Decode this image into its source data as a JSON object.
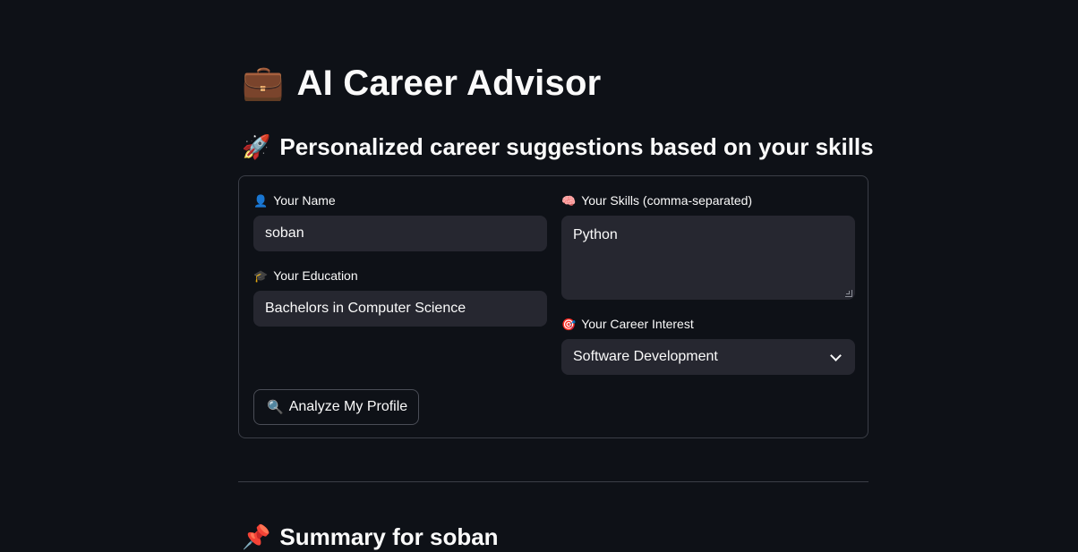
{
  "header": {
    "title_icon": "💼",
    "title": "AI Career Advisor",
    "subtitle_icon": "🚀",
    "subtitle": "Personalized career suggestions based on your skills"
  },
  "form": {
    "name": {
      "icon": "👤",
      "label": "Your Name",
      "value": "soban"
    },
    "education": {
      "icon": "🎓",
      "label": "Your Education",
      "value": "Bachelors in Computer Science"
    },
    "skills": {
      "icon": "🧠",
      "label": "Your Skills (comma-separated)",
      "value": "Python"
    },
    "interest": {
      "icon": "🎯",
      "label": "Your Career Interest",
      "value": "Software Development"
    },
    "analyze_button": {
      "icon": "🔍",
      "label": "Analyze My Profile"
    }
  },
  "summary": {
    "icon": "📌",
    "title": "Summary for soban"
  }
}
